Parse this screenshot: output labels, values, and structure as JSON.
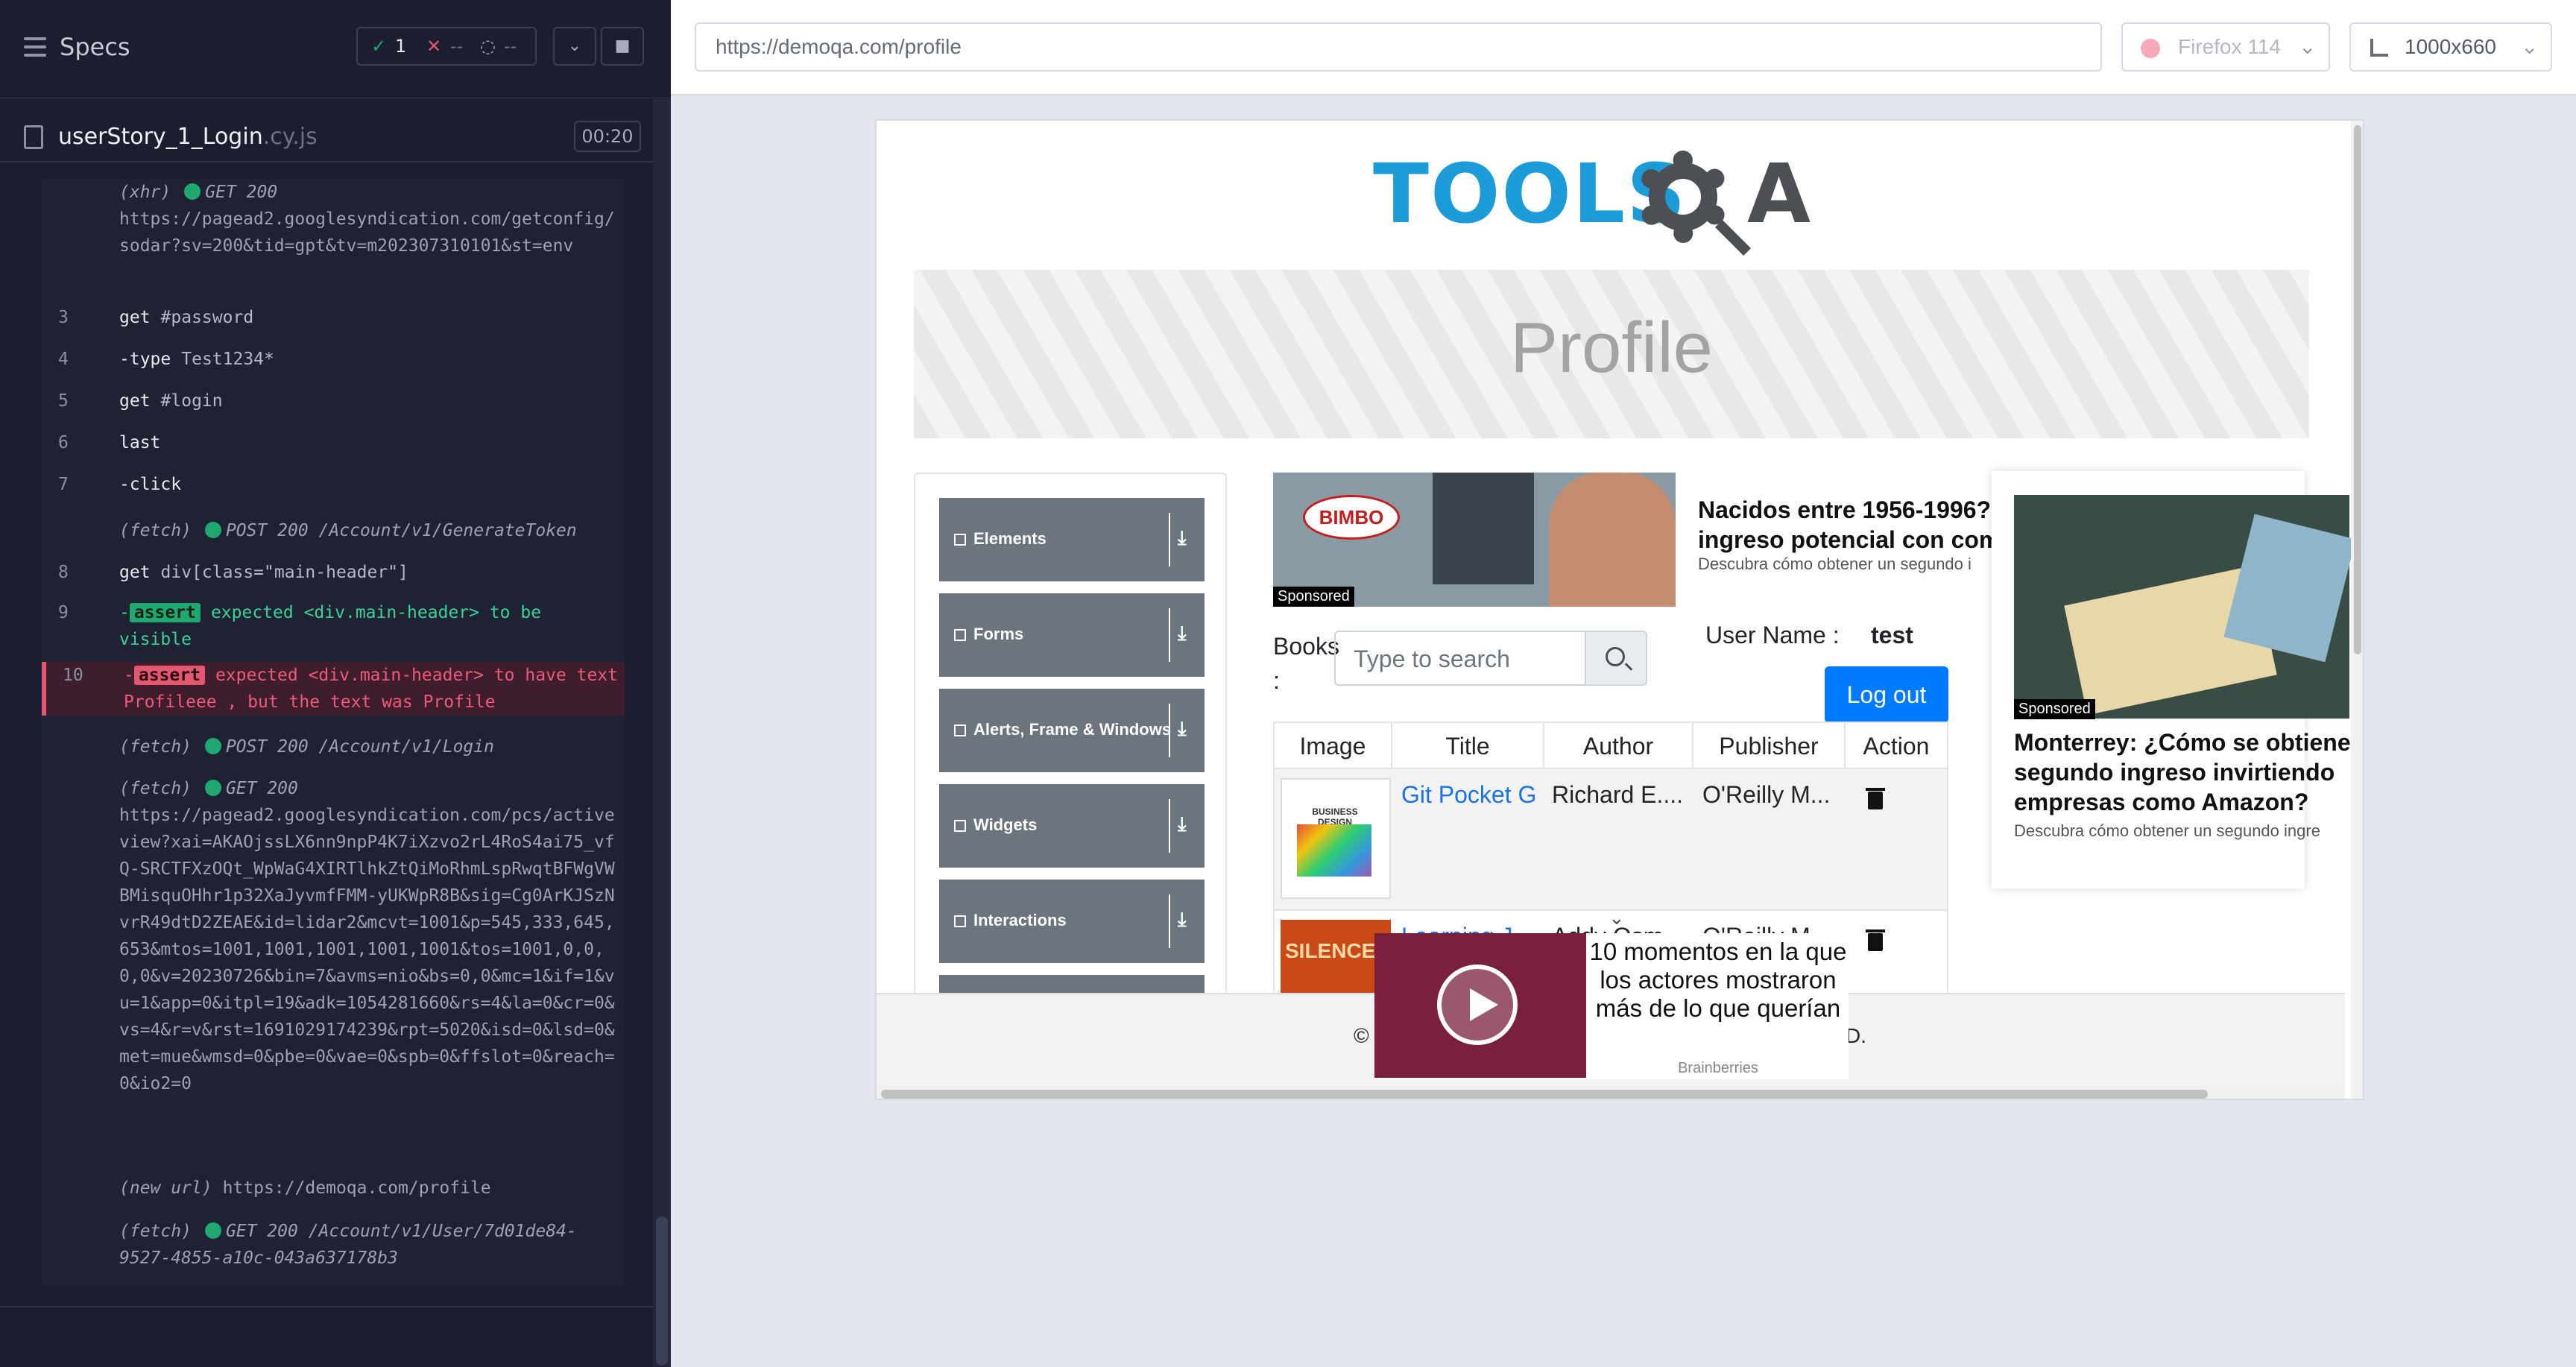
{
  "runner": {
    "title": "Specs",
    "stats": {
      "passed": "1",
      "failed": "--",
      "pending": "--"
    },
    "spec": {
      "name": "userStory_1_Login",
      "ext": ".cy.js",
      "duration": "00:20"
    },
    "log": [
      {
        "kind": "xhr",
        "n": "",
        "label": "(xhr)",
        "method": "GET 200",
        "url": "https://pagead2.googlesyndication.com/getconfig/sodar?sv=200&tid=gpt&tv=m202307310101&st=env"
      },
      {
        "kind": "cmd",
        "n": "3",
        "cmd": "get",
        "arg": "#password"
      },
      {
        "kind": "cmd",
        "n": "4",
        "cmd": "-type",
        "arg": "Test1234*"
      },
      {
        "kind": "cmd",
        "n": "5",
        "cmd": "get",
        "arg": "#login"
      },
      {
        "kind": "cmd",
        "n": "6",
        "cmd": "last",
        "arg": ""
      },
      {
        "kind": "cmd",
        "n": "7",
        "cmd": "-click",
        "arg": ""
      },
      {
        "kind": "xhr",
        "n": "",
        "label": "(fetch)",
        "method": "POST 200 /Account/v1/GenerateToken",
        "url": ""
      },
      {
        "kind": "cmd",
        "n": "8",
        "cmd": "get",
        "arg": "div[class=\"main-header\"]"
      },
      {
        "kind": "assert-pass",
        "n": "9",
        "badge": "assert",
        "text": "expected <div.main-header> to be visible"
      },
      {
        "kind": "assert-fail",
        "n": "10",
        "badge": "assert",
        "text": "expected <div.main-header> to have text Profileee , but the text was Profile"
      },
      {
        "kind": "xhr",
        "n": "",
        "label": "(fetch)",
        "method": "POST 200 /Account/v1/Login",
        "url": ""
      },
      {
        "kind": "xhr",
        "n": "",
        "label": "(fetch)",
        "method": "GET 200",
        "url": "https://pagead2.googlesyndication.com/pcs/activeview?xai=AKAOjssLX6nn9npP4K7iXzvo2rL4RoS4ai75_vfQ-SRCTFXzOQt_WpWaG4XIRTlhkZtQiMoRhmLspRwqtBFWgVWBMisquOHhr1p32XaJyvmfFMM-yUKWpR8B&sig=Cg0ArKJSzNvrR49dtD2ZEAE&id=lidar2&mcvt=1001&p=545,333,645,653&mtos=1001,1001,1001,1001,1001&tos=1001,0,0,0,0&v=20230726&bin=7&avms=nio&bs=0,0&mc=1&if=1&vu=1&app=0&itpl=19&adk=1054281660&rs=4&la=0&cr=0&vs=4&r=v&rst=1691029174239&rpt=5020&isd=0&lsd=0&met=mue&wmsd=0&pbe=0&vae=0&spb=0&ffslot=0&reach=0&io2=0"
      },
      {
        "kind": "xhr",
        "n": "",
        "label": "(new url)",
        "method": "",
        "url": "https://demoqa.com/profile",
        "nodot": true
      },
      {
        "kind": "xhr",
        "n": "",
        "label": "(fetch)",
        "method": "GET 200 /Account/v1/User/7d01de84-9527-4855-a10c-043a637178b3",
        "url": ""
      }
    ]
  },
  "browser": {
    "url": "https://demoqa.com/profile",
    "name": "Firefox 114",
    "viewport": "1000x660"
  },
  "page": {
    "logo": {
      "text": "TOOLS",
      "a": "A"
    },
    "title": "Profile",
    "sidebar": [
      "Elements",
      "Forms",
      "Alerts, Frame & Windows",
      "Widgets",
      "Interactions"
    ],
    "books_label": "Books :",
    "search_placeholder": "Type to search",
    "username_label": "User Name :",
    "username_value": "test",
    "logout_label": "Log out",
    "table_headers": [
      "Image",
      "Title",
      "Author",
      "Publisher",
      "Action"
    ],
    "rows": [
      {
        "title": "Git Pocket G",
        "author": "Richard E....",
        "publisher": "O'Reilly M...",
        "cover": "BUSINESS DESIGN"
      },
      {
        "title": "Learning J",
        "author": "Addy Osm...",
        "publisher": "O'Reilly M...",
        "cover": "SILENCE"
      }
    ],
    "ad1": {
      "brand": "BIMBO",
      "sponsored": "Sponsored",
      "headline": "Nacidos entre 1956-1996?",
      "headline2": "ingreso potencial con com",
      "sub": "Descubra cómo obtener un segundo i"
    },
    "ad2": {
      "sponsored": "Sponsored",
      "headline": "Monterrey: ¿Cómo se obtiene",
      "headline2": "segundo ingreso invirtiendo",
      "headline3": "empresas como Amazon?",
      "sub": "Descubra cómo obtener un segundo ingre"
    },
    "video": {
      "text": "10 momentos en la que los actores mostraron más de lo que querían",
      "source": "Brainberries"
    },
    "footer": {
      "left": "©",
      "right": "D."
    }
  },
  "colors": {
    "pass": "#1fa971",
    "fail": "#e45770",
    "primary": "#007bff",
    "toolsqa_blue": "#1b9bd7"
  }
}
